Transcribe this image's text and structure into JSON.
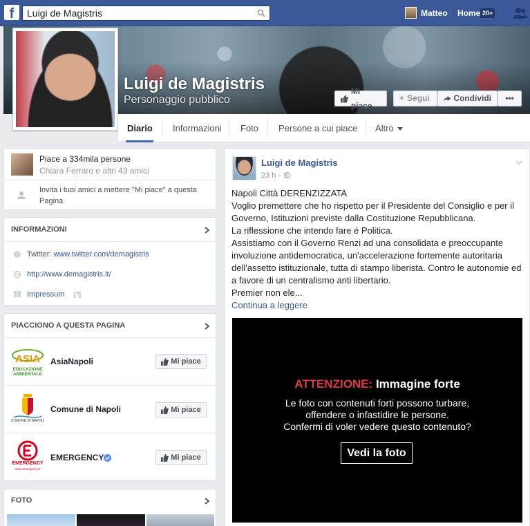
{
  "topbar": {
    "search_value": "Luigi de Magistris",
    "user_name": "Matteo",
    "home_label": "Home",
    "home_badge": "20+"
  },
  "cover": {
    "name": "Luigi de Magistris",
    "category": "Personaggio pubblico",
    "buttons": {
      "like": "Mi piace",
      "follow": "Segui",
      "share": "Condividi",
      "more": "•••"
    }
  },
  "tabs": [
    "Diario",
    "Informazioni",
    "Foto",
    "Persone a cui piace",
    "Altro"
  ],
  "likes_box": {
    "count_text": "Piace a 334mila persone",
    "friends_text": "Chiara Ferraro e altri 43 amici",
    "invite_text": "Invita i tuoi amici a mettere \"Mi piace\" a questa Pagina"
  },
  "info": {
    "title": "INFORMAZIONI",
    "twitter_prefix": "Twitter:",
    "twitter_link": "www.twitter.com/demagistris",
    "website": "http://www.demagistris.it/",
    "impressum": "Impressum",
    "impressum_help": "[?]"
  },
  "liked_pages": {
    "title": "PIACCIONO A QUESTA PAGINA",
    "button_label": "Mi piace",
    "items": [
      {
        "name": "AsiaNapoli",
        "logo_text": "ASIA",
        "logo_sub": "EDUCAZIONE AMBIENTALE",
        "logo_color": "#f29400"
      },
      {
        "name": "Comune di Napoli",
        "logo_text": "COMUNE DI NAPOLI",
        "logo_color": "#c8102e"
      },
      {
        "name": "EMERGENCY",
        "logo_text": "EMERGENCY",
        "logo_sub": "www.emergency.it",
        "logo_color": "#d6001c"
      }
    ]
  },
  "photos": {
    "title": "FOTO"
  },
  "post": {
    "author": "Luigi de Magistris",
    "time": "23 h ·",
    "lines": [
      "Napoli Città DERENZIZZATA",
      "Voglio premettere che ho rispetto per il Presidente del Consiglio e per il Governo, Istituzioni previste dalla Costituzione Repubblicana.",
      "La riflessione che intendo fare é Politica.",
      "Assistiamo con il Governo Renzi ad una consolidata e preoccupante involuzione antidemocratica, un'accelerazione fortemente autoritaria dell'assetto istituzionale, tutta di stampo liberista. Contro le autonomie ed a favore di un centralismo anti libertario.",
      "Premier non ele..."
    ],
    "continue": "Continua a leggere",
    "warning": {
      "label": "ATTENZIONE:",
      "title": "Immagine forte",
      "text_lines": [
        "Le foto con contenuti forti possono turbare,",
        "offendere o infastidire le persone.",
        "Confermi di voler vedere questo contenuto?"
      ],
      "button": "Vedi la foto"
    }
  },
  "colors": {
    "brand": "#3b5998",
    "link": "#365899",
    "warning_red": "#e5373f",
    "verified": "#5890ff"
  }
}
